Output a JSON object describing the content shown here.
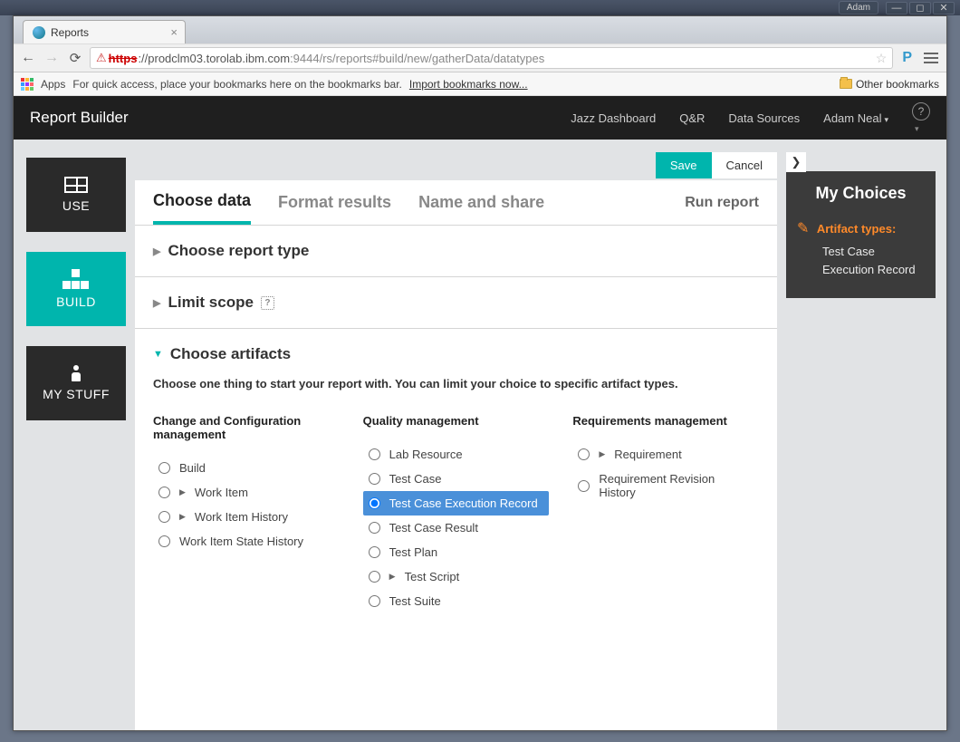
{
  "window": {
    "user_badge": "Adam"
  },
  "browser": {
    "tab_title": "Reports",
    "apps_label": "Apps",
    "bookmark_hint_prefix": "For quick access, place your bookmarks here on the bookmarks bar. ",
    "bookmark_hint_link": "Import bookmarks now...",
    "other_bookmarks": "Other bookmarks",
    "url_proto": "https",
    "url_host": "://prodclm03.torolab.ibm.com",
    "url_port": ":9444",
    "url_path": "/rs/reports#build/new/gatherData/datatypes"
  },
  "header": {
    "title": "Report Builder",
    "links": [
      "Jazz Dashboard",
      "Q&R",
      "Data Sources"
    ],
    "user": "Adam Neal"
  },
  "leftnav": {
    "use": "USE",
    "build": "BUILD",
    "mystuff": "MY STUFF"
  },
  "actions": {
    "save": "Save",
    "cancel": "Cancel"
  },
  "steps": {
    "choose_data": "Choose data",
    "format_results": "Format results",
    "name_share": "Name and share",
    "run_report": "Run report"
  },
  "sections": {
    "report_type": "Choose report type",
    "limit_scope": "Limit scope",
    "choose_artifacts": "Choose artifacts",
    "artifacts_desc": "Choose one thing to start your report with. You can limit your choice to specific artifact types."
  },
  "artifacts": {
    "ccm": {
      "title": "Change and Configuration management",
      "items": [
        {
          "label": "Build",
          "expandable": false
        },
        {
          "label": "Work Item",
          "expandable": true
        },
        {
          "label": "Work Item History",
          "expandable": true
        },
        {
          "label": "Work Item State History",
          "expandable": false
        }
      ]
    },
    "qm": {
      "title": "Quality management",
      "items": [
        {
          "label": "Lab Resource",
          "expandable": false
        },
        {
          "label": "Test Case",
          "expandable": false
        },
        {
          "label": "Test Case Execution Record",
          "expandable": false,
          "selected": true
        },
        {
          "label": "Test Case Result",
          "expandable": false
        },
        {
          "label": "Test Plan",
          "expandable": false
        },
        {
          "label": "Test Script",
          "expandable": true
        },
        {
          "label": "Test Suite",
          "expandable": false
        }
      ]
    },
    "rm": {
      "title": "Requirements management",
      "items": [
        {
          "label": "Requirement",
          "expandable": true
        },
        {
          "label": "Requirement Revision History",
          "expandable": false
        }
      ]
    }
  },
  "choices": {
    "title": "My Choices",
    "artifact_types_label": "Artifact types:",
    "artifact_types_value": "Test Case Execution Record"
  }
}
